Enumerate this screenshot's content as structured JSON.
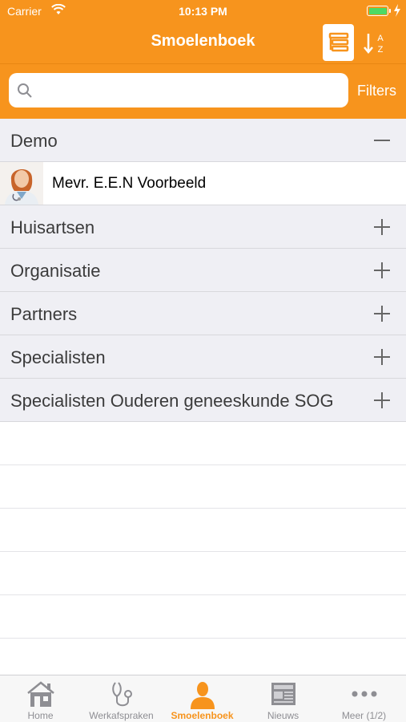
{
  "status_bar": {
    "carrier": "Carrier",
    "time": "10:13 PM"
  },
  "nav": {
    "title": "Smoelenboek",
    "list_icon": "list-view-icon",
    "sort_icon": "sort-az-icon"
  },
  "search": {
    "placeholder": "",
    "value": "",
    "filters_label": "Filters"
  },
  "groups": [
    {
      "label": "Demo",
      "expanded": true,
      "toggle_icon": "minus-icon"
    },
    {
      "label": "Huisartsen",
      "expanded": false,
      "toggle_icon": "plus-icon"
    },
    {
      "label": "Organisatie",
      "expanded": false,
      "toggle_icon": "plus-icon"
    },
    {
      "label": "Partners",
      "expanded": false,
      "toggle_icon": "plus-icon"
    },
    {
      "label": "Specialisten",
      "expanded": false,
      "toggle_icon": "plus-icon"
    },
    {
      "label": "Specialisten Ouderen geneeskunde SOG",
      "expanded": false,
      "toggle_icon": "plus-icon"
    }
  ],
  "demo_people": [
    {
      "name": "Mevr. E.E.N Voorbeeld"
    }
  ],
  "tabs": [
    {
      "label": "Home",
      "icon": "home-icon",
      "active": false
    },
    {
      "label": "Werkafspraken",
      "icon": "stethoscope-icon",
      "active": false
    },
    {
      "label": "Smoelenboek",
      "icon": "person-icon",
      "active": true
    },
    {
      "label": "Nieuws",
      "icon": "newspaper-icon",
      "active": false
    },
    {
      "label": "Meer (1/2)",
      "icon": "more-icon",
      "active": false
    }
  ],
  "colors": {
    "accent": "#f7941d",
    "group_bg": "#efeff4",
    "tab_inactive": "#8e8e93"
  }
}
